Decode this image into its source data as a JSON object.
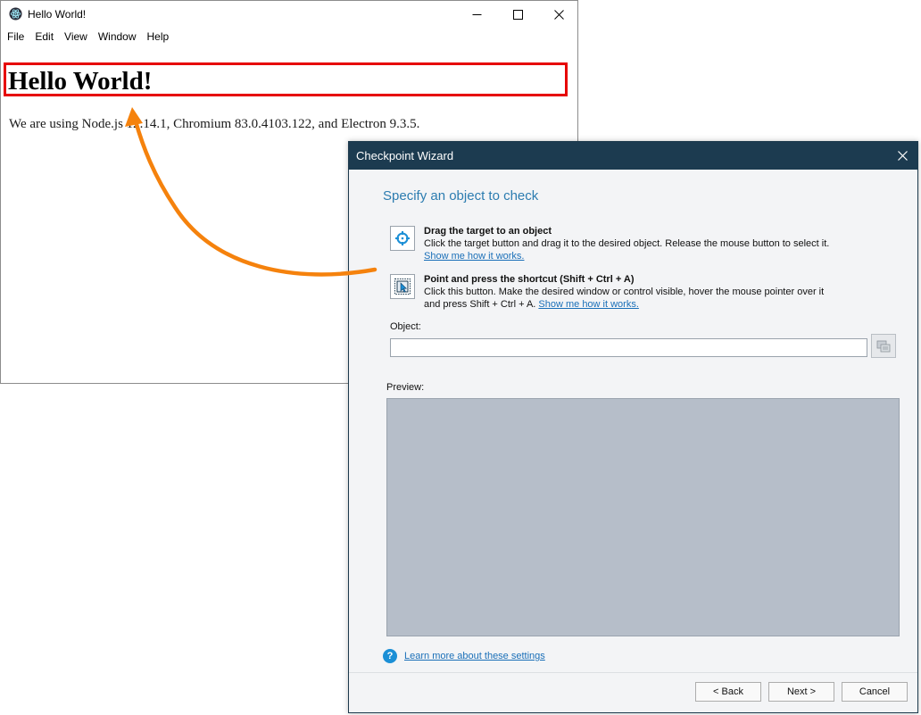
{
  "electron_window": {
    "title": "Hello World!",
    "menu": [
      "File",
      "Edit",
      "View",
      "Window",
      "Help"
    ],
    "heading": "Hello World!",
    "versions_text": "We are using Node.js 12.14.1, Chromium 83.0.4103.122, and Electron 9.3.5."
  },
  "wizard": {
    "title": "Checkpoint Wizard",
    "heading": "Specify an object to check",
    "options": [
      {
        "icon": "crosshair-target-icon",
        "title": "Drag the target to an object",
        "desc_line1": "Click the target button and drag it to the desired object. Release the mouse button to select it.",
        "desc_line2": "",
        "link": "Show me how it works."
      },
      {
        "icon": "point-shortcut-icon",
        "title": "Point and press the shortcut (Shift + Ctrl + A)",
        "desc_line1": "Click this button. Make the desired window or control visible, hover the mouse pointer over it",
        "desc_line2": "and press Shift + Ctrl + A.",
        "link": "Show me how it works."
      }
    ],
    "object_label": "Object:",
    "object_value": "",
    "preview_label": "Preview:",
    "help_link": "Learn more about these settings",
    "buttons": {
      "back": "< Back",
      "next": "Next >",
      "cancel": "Cancel"
    }
  },
  "colors": {
    "highlight_box": "#e60000",
    "arrow": "#f5820d",
    "wizard_title_bar": "#1c3b50",
    "wizard_heading": "#2c7cb0",
    "link": "#1a6fb8",
    "preview_bg": "#b6bec9"
  }
}
